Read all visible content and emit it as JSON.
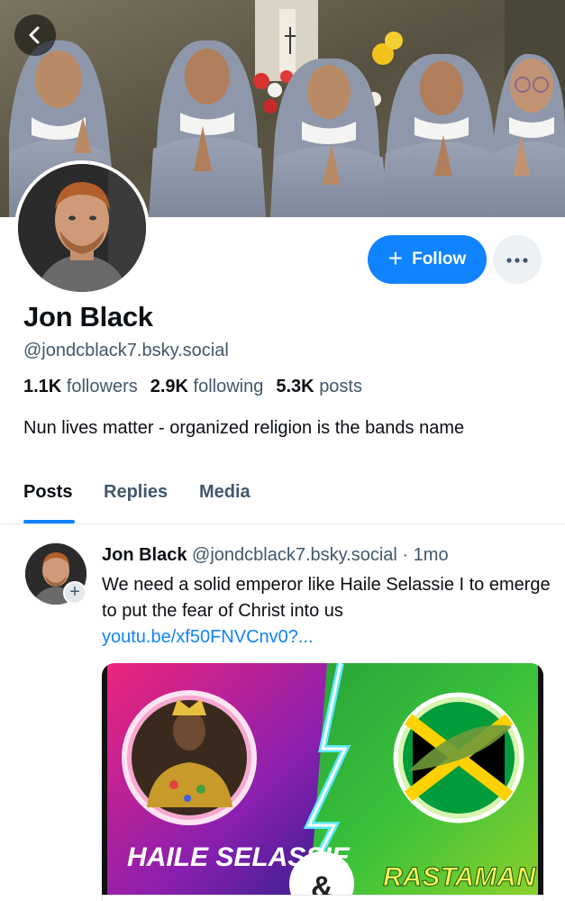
{
  "profile": {
    "display_name": "Jon Black",
    "handle": "@jondcblack7.bsky.social",
    "followers_count": "1.1K",
    "followers_label": "followers",
    "following_count": "2.9K",
    "following_label": "following",
    "posts_count": "5.3K",
    "posts_label": "posts",
    "bio": "Nun lives matter - organized religion is the bands name"
  },
  "actions": {
    "follow_label": "Follow",
    "more_icon": "ellipsis-icon",
    "back_icon": "chevron-left-icon"
  },
  "tabs": [
    {
      "label": "Posts",
      "active": true
    },
    {
      "label": "Replies",
      "active": false
    },
    {
      "label": "Media",
      "active": false
    }
  ],
  "post": {
    "author": "Jon Black",
    "handle": "@jondcblack7.bsky.social",
    "separator": "·",
    "time": "1mo",
    "text": "We need a solid emperor like Haile Selassie I to emerge to put the fear of Christ into us",
    "link_text": "youtu.be/xf50FNVCnv0?...",
    "media": {
      "left_caption": "HAILE SELASSIE",
      "ampersand": "&",
      "right_caption": "RASTAMAN"
    }
  },
  "colors": {
    "accent": "#1083fe",
    "text_primary": "#0b0f14",
    "text_secondary": "#42576c"
  }
}
